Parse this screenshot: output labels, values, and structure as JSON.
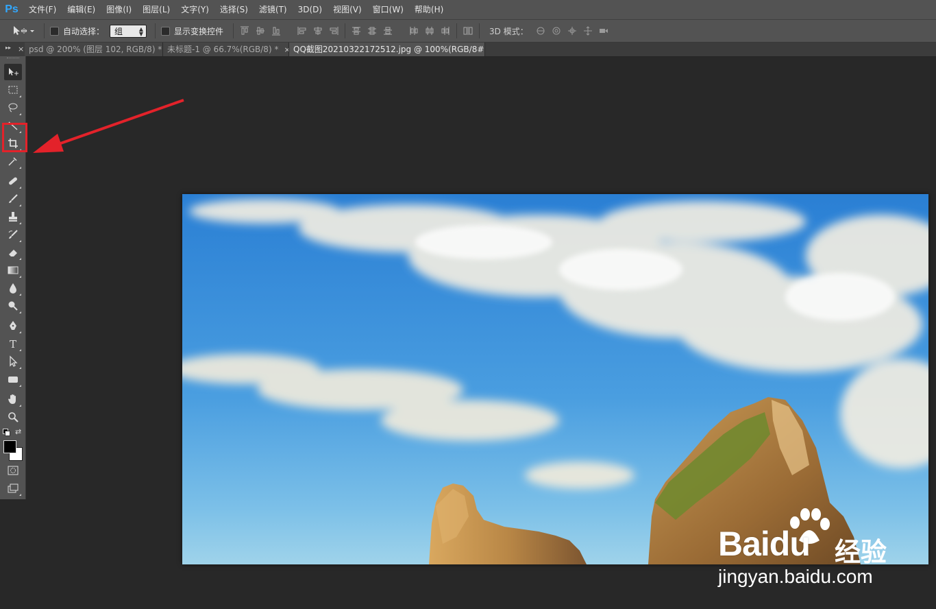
{
  "app": {
    "logo": "Ps"
  },
  "menu": [
    "文件(F)",
    "编辑(E)",
    "图像(I)",
    "图层(L)",
    "文字(Y)",
    "选择(S)",
    "滤镜(T)",
    "3D(D)",
    "视图(V)",
    "窗口(W)",
    "帮助(H)"
  ],
  "options": {
    "auto_select_label": "自动选择：",
    "auto_select_value": "组",
    "show_transform_label": "显示变换控件",
    "mode_3d_label": "3D 模式："
  },
  "tabs": [
    {
      "title": "psd @ 200% (图层 102, RGB/8) *",
      "close": "×"
    },
    {
      "title": "未标题-1 @ 66.7%(RGB/8) *",
      "close": "×"
    },
    {
      "title": "QQ截图20210322172512.jpg @ 100%(RGB/8#)",
      "close": "×"
    }
  ],
  "tools": [
    "move-tool",
    "marquee-tool",
    "lasso-tool",
    "quick-selection-tool",
    "crop-tool",
    "eyedropper-tool",
    "healing-brush-tool",
    "brush-tool",
    "clone-stamp-tool",
    "history-brush-tool",
    "eraser-tool",
    "gradient-tool",
    "blur-tool",
    "dodge-tool",
    "pen-tool",
    "type-tool",
    "path-selection-tool",
    "rectangle-tool",
    "hand-tool",
    "zoom-tool"
  ],
  "colors": {
    "foreground": "#000000",
    "background": "#ffffff",
    "highlight": "#e3222a",
    "ps_blue": "#31a8ff"
  },
  "watermark": {
    "brand": "Baidu",
    "jingyan": "经验",
    "url": "jingyan.baidu.com"
  }
}
